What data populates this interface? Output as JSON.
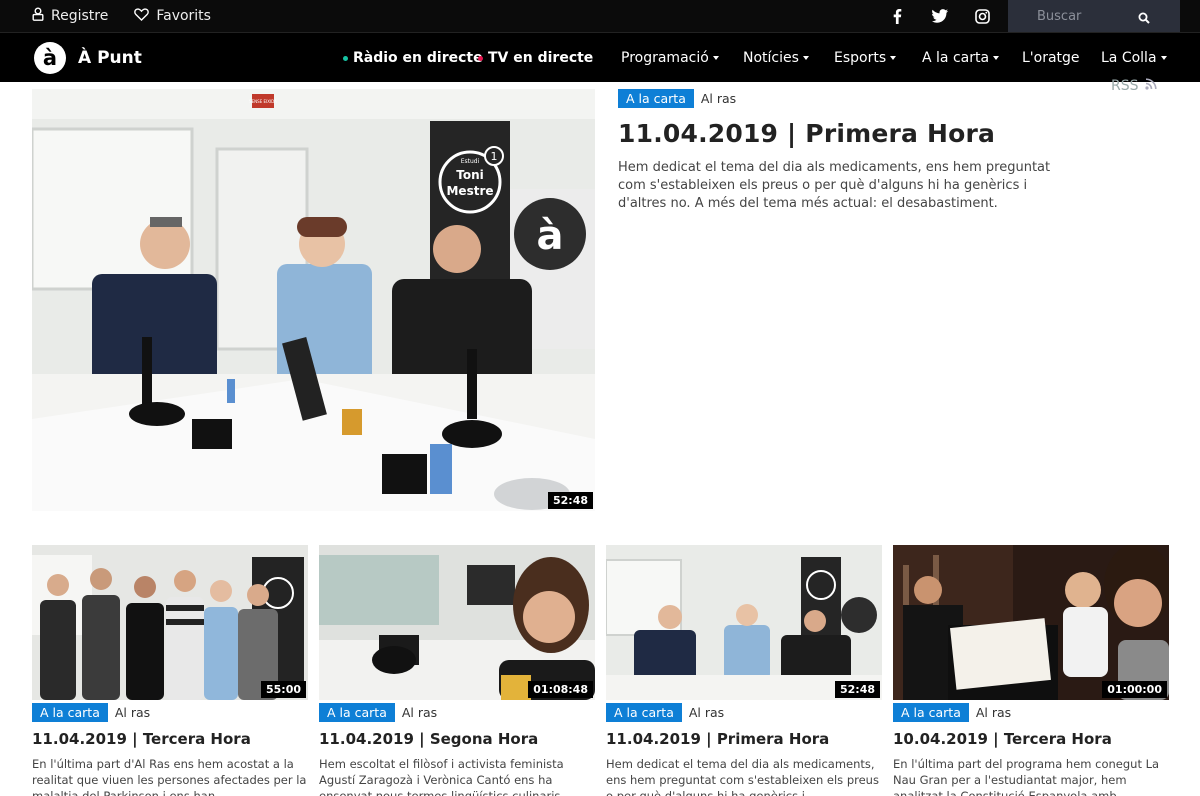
{
  "topbar": {
    "register_label": "Registre",
    "favorites_label": "Favorits",
    "search_placeholder": "Buscar"
  },
  "navbar": {
    "brand_name": "À Punt",
    "logo_glyph": "à",
    "live_radio": "Ràdio en directe",
    "live_tv": "TV en directe",
    "live_radio_color": "#17c3a3",
    "live_tv_color": "#e5164f",
    "menu": [
      {
        "label": "Programació"
      },
      {
        "label": "Notícies"
      },
      {
        "label": "Esports"
      },
      {
        "label": "A la carta"
      },
      {
        "label": "L'oratge"
      },
      {
        "label": "La Colla"
      }
    ]
  },
  "rss_label": "RSS",
  "hero": {
    "tag": "A la carta",
    "section": "Al ras",
    "title": "11.04.2019 | Primera Hora",
    "description": "Hem dedicat el tema del dia als medicaments, ens hem preguntat com s'estableixen els preus o per què d'alguns hi ha genèrics i d'altres no. A més del tema més actual: el desabastiment.",
    "duration": "52:48",
    "studio_sign_line1": "Estudi",
    "studio_sign_line2": "Toni",
    "studio_sign_line3": "Mestre",
    "studio_sign_number": "1",
    "door_sign": "SENSE EIXIDA"
  },
  "cards": [
    {
      "tag": "A la carta",
      "section": "Al ras",
      "title": "11.04.2019 | Tercera Hora",
      "description": "En l'última part d'Al Ras ens hem acostat a la realitat que viuen les persones afectades per la malaltia del Parkinson i ens han...",
      "duration": "55:00"
    },
    {
      "tag": "A la carta",
      "section": "Al ras",
      "title": "11.04.2019 | Segona Hora",
      "description": "Hem escoltat el filòsof i activista feminista Agustí Zaragozà i Verònica Cantó ens ha ensenyat nous termes lingüístics culinaris.",
      "duration": "01:08:48"
    },
    {
      "tag": "A la carta",
      "section": "Al ras",
      "title": "11.04.2019 | Primera Hora",
      "description": "Hem dedicat el tema del dia als medicaments, ens hem preguntat com s'estableixen els preus o per què d'alguns hi ha genèrics i",
      "duration": "52:48"
    },
    {
      "tag": "A la carta",
      "section": "Al ras",
      "title": "10.04.2019 | Tercera Hora",
      "description": "En l'última part del programa hem conegut La Nau Gran per a l'estudiantat major, hem analitzat la Constitució Espanyola amb",
      "duration": "01:00:00"
    }
  ]
}
